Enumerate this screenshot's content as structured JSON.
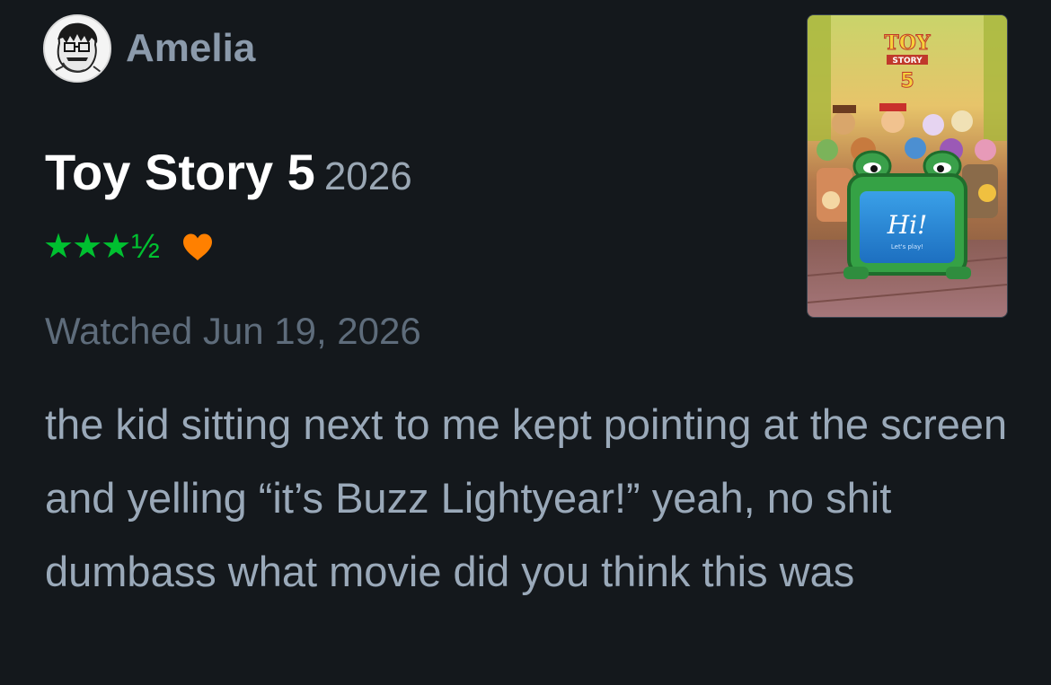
{
  "user": {
    "name": "Amelia",
    "avatar_icon": "sketch-portrait-avatar"
  },
  "film": {
    "title": "Toy Story 5",
    "year": "2026",
    "poster": {
      "logo_line1": "TOY",
      "logo_line2": "STORY",
      "logo_line3": "5",
      "tablet_text": "Hi!",
      "tablet_subtext": "Let's play!"
    }
  },
  "rating": {
    "stars": "★★★",
    "half": "½",
    "value": 3.5,
    "max": 5,
    "liked": true,
    "star_color": "#00c030",
    "heart_color": "#ff8000"
  },
  "watched": "Watched Jun 19, 2026",
  "review_text": "the kid sitting next to me kept pointing at the screen and yelling “it’s Buzz Lightyear!” yeah, no shit dumbass what movie did you think this was",
  "colors": {
    "background": "#14181c",
    "title": "#ffffff",
    "muted": "#5e6c7b",
    "text": "#9aa9b9"
  }
}
